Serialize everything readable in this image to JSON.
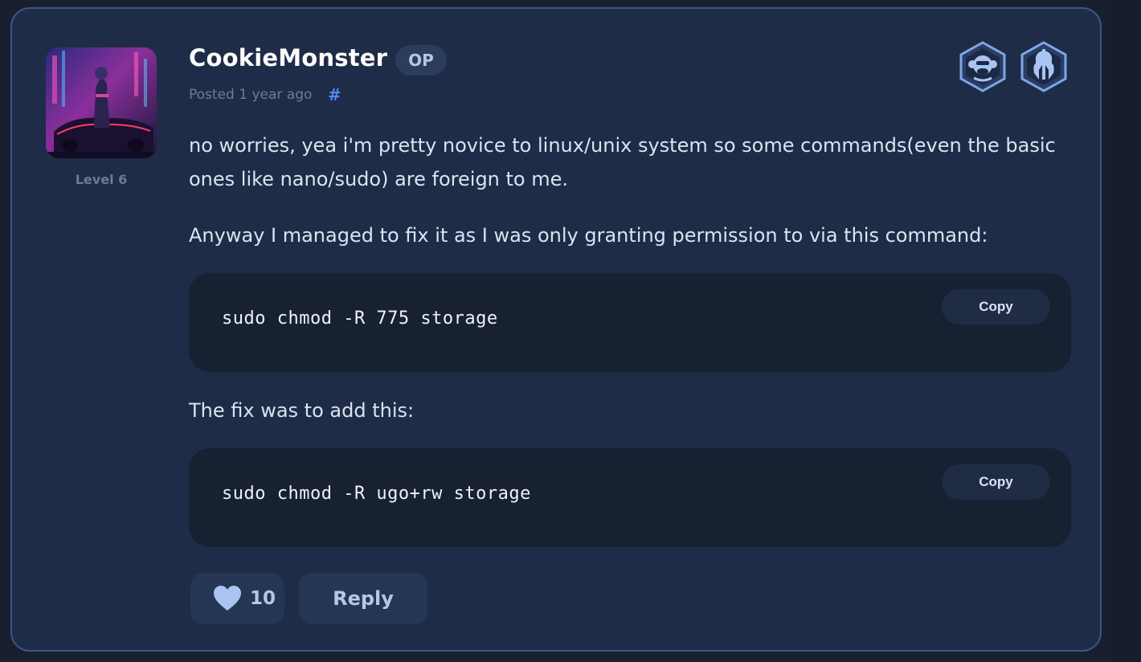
{
  "post": {
    "author": {
      "name": "CookieMonster",
      "op_label": "OP",
      "level": "Level 6",
      "avatar": "cyberpunk-avatar"
    },
    "meta": {
      "posted": "Posted 1 year ago",
      "permalink_symbol": "#"
    },
    "badges": [
      {
        "icon": "monkey-badge-icon"
      },
      {
        "icon": "spartan-helmet-badge-icon"
      }
    ],
    "paragraphs": [
      "no worries, yea i'm pretty novice to linux/unix system so some commands(even the basic ones like nano/sudo) are foreign to me.",
      "Anyway I managed to fix it as I was only granting permission to via this command:",
      "The fix was to add this:"
    ],
    "code_blocks": [
      {
        "code": "sudo chmod -R 775 storage",
        "copy_label": "Copy"
      },
      {
        "code": "sudo chmod -R ugo+rw storage",
        "copy_label": "Copy"
      }
    ],
    "actions": {
      "like_icon": "heart-icon",
      "like_count": "10",
      "reply_label": "Reply"
    }
  },
  "colors": {
    "card_bg": "#1f2c47",
    "card_border": "#3c5584",
    "code_bg": "#172132",
    "accent": "#4a8cf0",
    "text": "#dbe3f1"
  }
}
